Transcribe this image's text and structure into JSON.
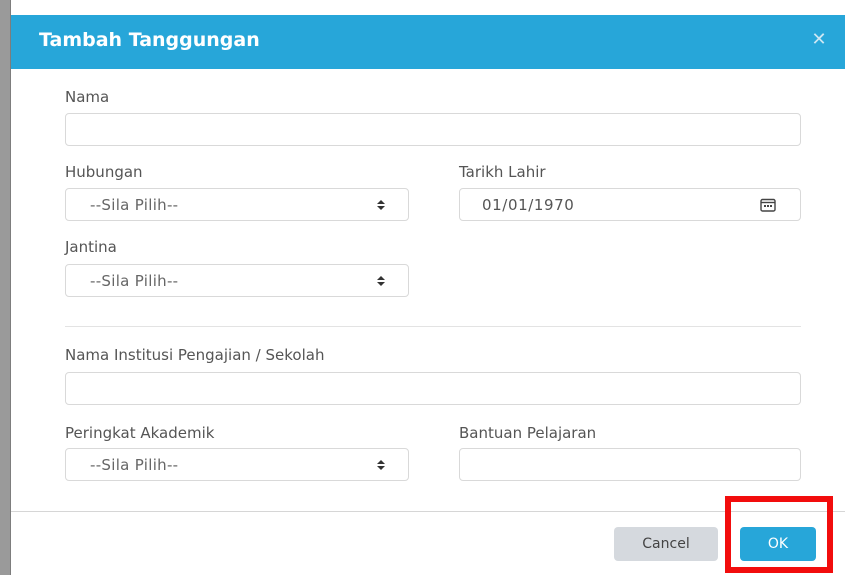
{
  "dialog": {
    "title": "Tambah Tanggungan",
    "close_icon": "close-icon"
  },
  "form": {
    "nama": {
      "label": "Nama",
      "value": ""
    },
    "hubungan": {
      "label": "Hubungan",
      "selected": "--Sila Pilih--"
    },
    "tarikh_lahir": {
      "label": "Tarikh Lahir",
      "value": "01/01/1970",
      "icon": "calendar-icon"
    },
    "jantina": {
      "label": "Jantina",
      "selected": "--Sila Pilih--"
    },
    "institusi": {
      "label": "Nama Institusi Pengajian / Sekolah",
      "value": ""
    },
    "peringkat": {
      "label": "Peringkat Akademik",
      "selected": "--Sila Pilih--"
    },
    "bantuan": {
      "label": "Bantuan Pelajaran",
      "value": ""
    }
  },
  "footer": {
    "cancel_label": "Cancel",
    "ok_label": "OK"
  },
  "colors": {
    "header": "#27a6d9",
    "ok_button": "#27a6d9",
    "cancel_button": "#d5d9de",
    "highlight": "#f20d0d"
  }
}
